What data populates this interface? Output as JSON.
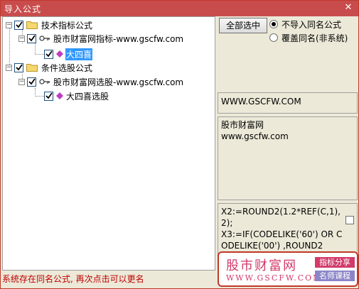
{
  "window": {
    "title": "导入公式",
    "close_glyph": "✕"
  },
  "tree": {
    "nodes": [
      {
        "label": "技术指标公式"
      },
      {
        "label": "股市财富网指标-www.gscfw.com"
      },
      {
        "label": "大四喜"
      },
      {
        "label": "条件选股公式"
      },
      {
        "label": "股市财富网选股-www.gscfw.com"
      },
      {
        "label": "大四喜选股"
      }
    ]
  },
  "options": {
    "select_all_label": "全部选中",
    "radio_no_import": "不导入同名公式",
    "radio_overwrite": "覆盖同名(非系统)"
  },
  "info": {
    "website": "WWW.GSCFW.COM",
    "desc_line1": "股市财富网",
    "desc_line2": "www.gscfw.com",
    "code": "X2:=ROUND2(1.2*REF(C,1),2);\nX3:=IF(CODELIKE('60') OR CODELIKE('00') ,ROUND2"
  },
  "status": {
    "message": "系统存在同名公式, 再次点击可以更名"
  },
  "watermark": {
    "title": "股市财富网",
    "url": "WWW.GSCFW.COM",
    "tag1": "指标分享",
    "tag2": "名师课程"
  },
  "colors": {
    "titlebar": "#c94c4c",
    "selection": "#3399ff",
    "status": "#c00000"
  }
}
